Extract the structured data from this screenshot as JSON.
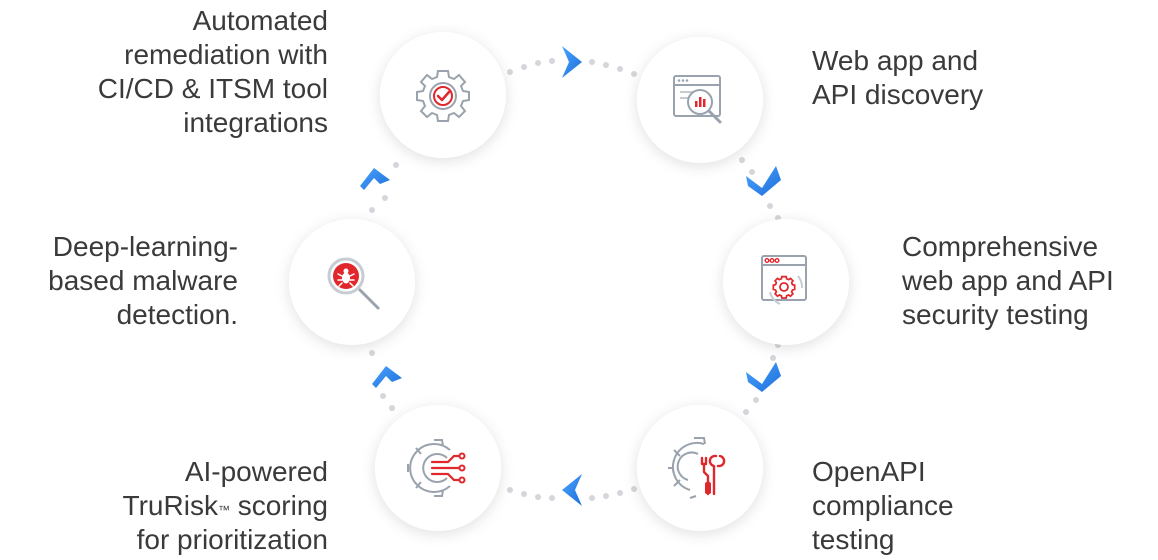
{
  "steps": [
    {
      "id": "discovery",
      "lines": [
        "Web app and",
        "API discovery"
      ],
      "icon": "web-app-discovery-icon"
    },
    {
      "id": "testing",
      "lines": [
        "Comprehensive",
        "web app and API",
        "security testing"
      ],
      "icon": "browser-gear-icon"
    },
    {
      "id": "compliance",
      "lines": [
        "OpenAPI",
        "compliance",
        "testing"
      ],
      "icon": "gear-tools-icon"
    },
    {
      "id": "trurisk",
      "lines": [
        "AI-powered",
        "TruRisk",
        "scoring",
        "for prioritization"
      ],
      "tm": "™",
      "icon": "gear-circuit-icon"
    },
    {
      "id": "malware",
      "lines": [
        "Deep-learning-",
        "based malware",
        "detection."
      ],
      "icon": "bug-magnifier-icon"
    },
    {
      "id": "remediation",
      "lines": [
        "Automated",
        "remediation with",
        "CI/CD & ITSM tool",
        "integrations"
      ],
      "icon": "gear-check-icon"
    }
  ],
  "colors": {
    "accent_red": "#e0282c",
    "accent_blue": "#2f80ed",
    "icon_gray": "#9aa3ad",
    "text": "#3a3a3a",
    "dot": "#d3d6da"
  }
}
